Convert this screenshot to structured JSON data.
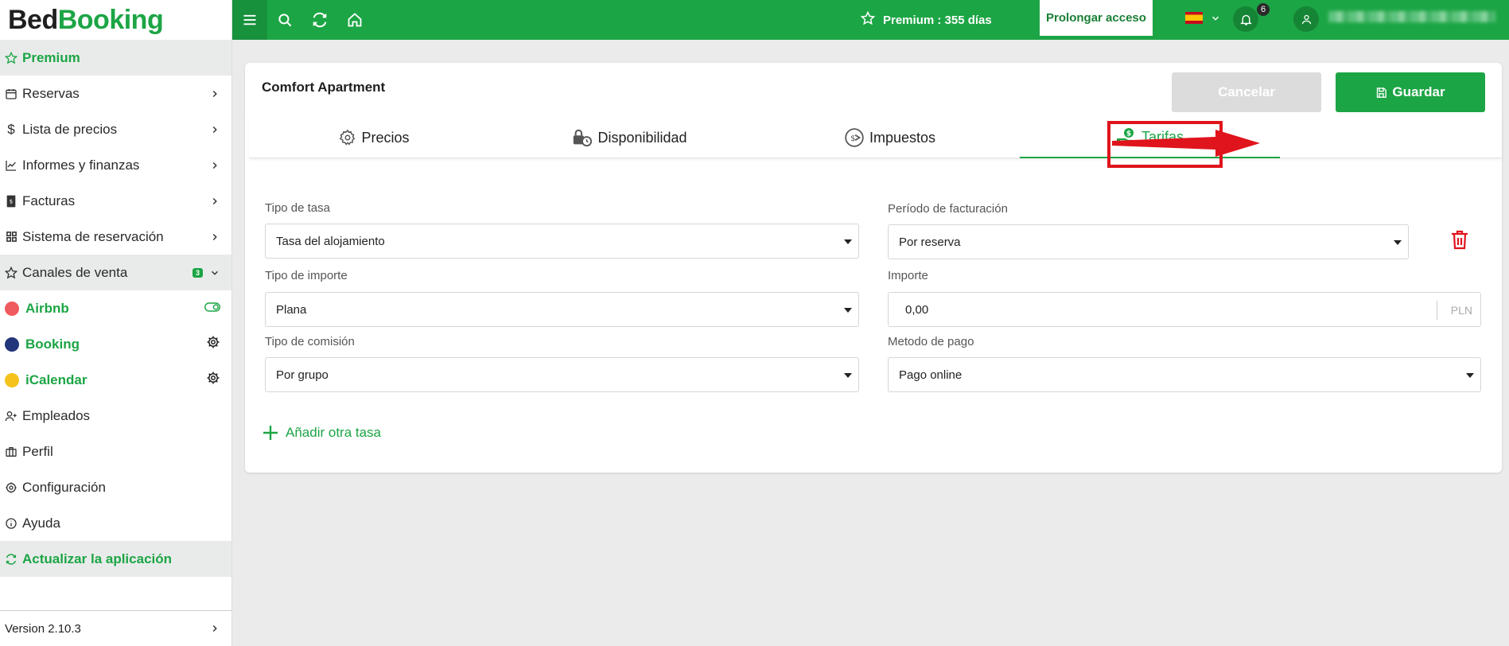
{
  "logo": {
    "part1": "Bed",
    "part2": "Booking"
  },
  "sidebar": {
    "items": [
      {
        "label": "Premium"
      },
      {
        "label": "Reservas"
      },
      {
        "label": "Lista de precios"
      },
      {
        "label": "Informes y finanzas"
      },
      {
        "label": "Facturas"
      },
      {
        "label": "Sistema de reservación"
      },
      {
        "label": "Canales de venta",
        "badge": "3"
      },
      {
        "label": "Airbnb",
        "dot_color": "#ef5a5f"
      },
      {
        "label": "Booking",
        "dot_color": "#22347a"
      },
      {
        "label": "iCalendar",
        "dot_color": "#f5c21c"
      },
      {
        "label": "Empleados"
      },
      {
        "label": "Perfil"
      },
      {
        "label": "Configuración"
      },
      {
        "label": "Ayuda"
      },
      {
        "label": "Actualizar la aplicación"
      }
    ],
    "version": "Version 2.10.3"
  },
  "topbar": {
    "premium_prefix": "Premium : ",
    "premium_days": "355 días",
    "prolong_label": "Prolongar acceso",
    "notifications": "6"
  },
  "card": {
    "title": "Comfort Apartment",
    "cancel_label": "Cancelar",
    "save_label": "Guardar",
    "tabs": [
      {
        "label": "Precios"
      },
      {
        "label": "Disponibilidad"
      },
      {
        "label": "Impuestos"
      },
      {
        "label": "Tarifas"
      }
    ]
  },
  "form": {
    "rate_type": {
      "label": "Tipo de tasa",
      "value": "Tasa del alojamiento"
    },
    "billing_period": {
      "label": "Período de facturación",
      "value": "Por reserva"
    },
    "amount_type": {
      "label": "Tipo de importe",
      "value": "Plana"
    },
    "amount": {
      "label": "Importe",
      "value": "0,00",
      "currency": "PLN"
    },
    "commission_type": {
      "label": "Tipo de comisión",
      "value": "Por grupo"
    },
    "payment_method": {
      "label": "Metodo de pago",
      "value": "Pago online"
    },
    "add_rate_label": "Añadir otra tasa"
  },
  "colors": {
    "brand": "#1ca545",
    "highlight": "#e0141c"
  }
}
